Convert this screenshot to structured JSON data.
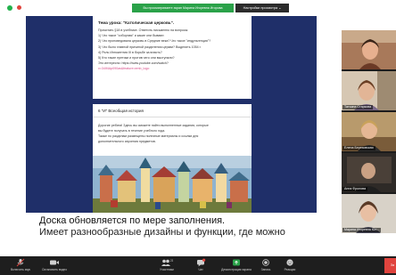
{
  "share_bar": {
    "banner_text": "Вы просматриваете экран Марина Игоревна Игорова",
    "view_options_label": "Настройки просмотра ⌄"
  },
  "card_1": {
    "title": "Тема урока: \"Католическая церковь\".",
    "lines": [
      "Прочитать §18 в учебнике. Ответить письменно на вопросы:",
      "1) Что такое \"соборная\" и какие они бывают.",
      "2) Что проповедовала церковь в Средние века? Что такое \"индульгенция\"?",
      "3) Что было главной причиной разделения церкви? Выделить 1054 г.",
      "4) Роль Иннокентия III в борьбе за власть?",
      "5) Кто такие еретики и против чего они выступали?",
      "Это интересно: https://www.youtube.com/watch?",
      "v=34lf4Ap090as&feature=emb_logo"
    ]
  },
  "card_2": {
    "title": "6 \"И\" Всеобщая история",
    "lines": [
      "Дорогие ребята! Здесь вы сможете найти выполненные задания, которые",
      "вы будете получать в течение учебного года.",
      "Также по разделам размещены полезные материалы и ссылки для",
      "дополнительного изучения предметов."
    ]
  },
  "caption": {
    "line1": "Доска обновляется по мере заполнения.",
    "line2": "Имеет разнообразные дизайны и функции, где можно"
  },
  "participants": [
    {
      "name": ""
    },
    {
      "name": "Татьяна Старкова"
    },
    {
      "name": "Елена Березовская"
    },
    {
      "name": "Анна Фролова"
    },
    {
      "name": "Марина Игоревна Юн..."
    }
  ],
  "toolbar": {
    "mic_label": "Включить звук",
    "video_label": "Остановить видео",
    "participants_label": "Участники",
    "participants_count": "21",
    "chat_label": "Чат",
    "share_label": "Демонстрация экрана",
    "record_label": "Запись",
    "reactions_label": "Реакции",
    "end_label": "За"
  },
  "colors": {
    "board_bg": "#1f2f69",
    "share_green": "#2aa249",
    "link_pink": "#d64a87",
    "toolbar_bg": "#1e1e1e",
    "end_red": "#e0443e"
  }
}
